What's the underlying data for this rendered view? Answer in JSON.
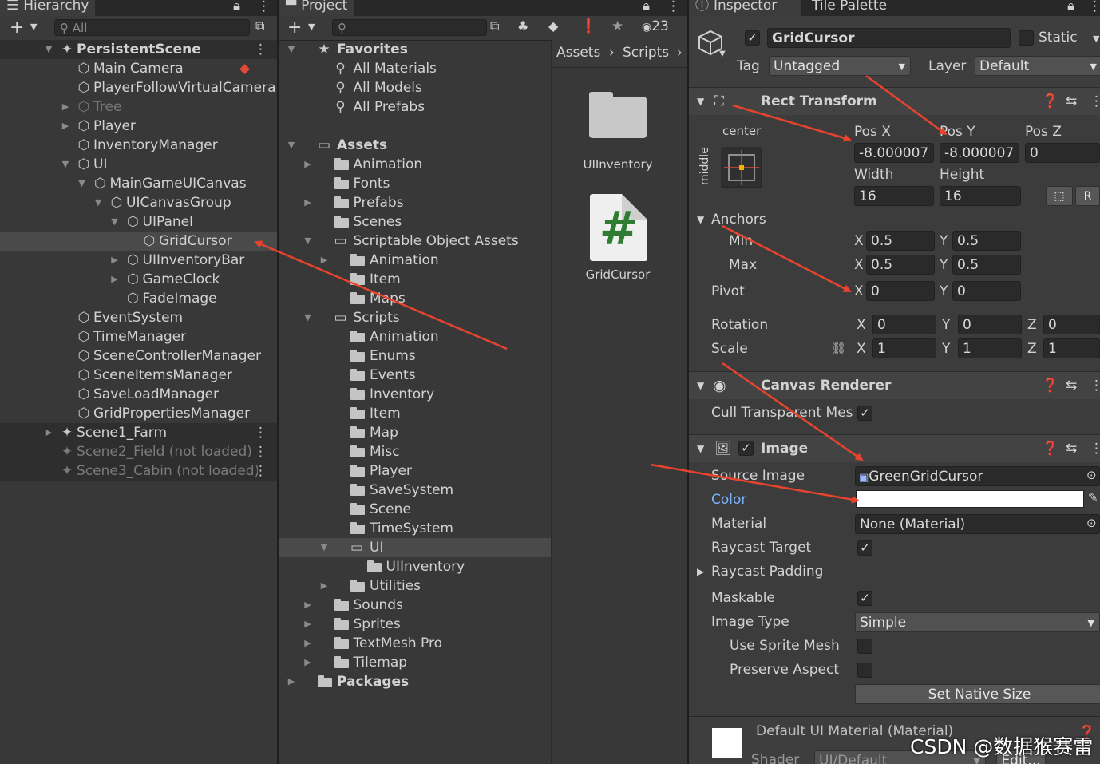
{
  "hierarchy": {
    "tab": "Hierarchy",
    "search": "All",
    "rows": [
      {
        "label": "PersistentScene",
        "depth": 0,
        "icon": "scene-icon",
        "arrow": "open",
        "scene": true,
        "bold": true,
        "menu": true
      },
      {
        "label": "Main Camera",
        "depth": 2,
        "icon": "cube-icon",
        "arrow": "",
        "badge": true
      },
      {
        "label": "PlayerFollowVirtualCamera",
        "depth": 2,
        "icon": "cube-icon",
        "arrow": ""
      },
      {
        "label": "Tree",
        "depth": 2,
        "icon": "cube-icon",
        "arrow": "closed",
        "dim": true
      },
      {
        "label": "Player",
        "depth": 2,
        "icon": "cube-icon",
        "arrow": "closed"
      },
      {
        "label": "InventoryManager",
        "depth": 2,
        "icon": "cube-icon",
        "arrow": ""
      },
      {
        "label": "UI",
        "depth": 2,
        "icon": "cube-icon",
        "arrow": "open"
      },
      {
        "label": "MainGameUICanvas",
        "depth": 3,
        "icon": "cube-icon",
        "arrow": "open"
      },
      {
        "label": "UICanvasGroup",
        "depth": 4,
        "icon": "cube-icon",
        "arrow": "open"
      },
      {
        "label": "UIPanel",
        "depth": 5,
        "icon": "cube-icon",
        "arrow": "open"
      },
      {
        "label": "GridCursor",
        "depth": 6,
        "icon": "cube-icon",
        "arrow": "",
        "selected": true
      },
      {
        "label": "UIInventoryBar",
        "depth": 5,
        "icon": "cube-icon",
        "arrow": "closed"
      },
      {
        "label": "GameClock",
        "depth": 5,
        "icon": "cube-icon",
        "arrow": "closed"
      },
      {
        "label": "FadeImage",
        "depth": 5,
        "icon": "cube-icon",
        "arrow": ""
      },
      {
        "label": "EventSystem",
        "depth": 2,
        "icon": "cube-icon",
        "arrow": ""
      },
      {
        "label": "TimeManager",
        "depth": 2,
        "icon": "cube-icon",
        "arrow": ""
      },
      {
        "label": "SceneControllerManager",
        "depth": 2,
        "icon": "cube-icon",
        "arrow": ""
      },
      {
        "label": "SceneItemsManager",
        "depth": 2,
        "icon": "cube-icon",
        "arrow": ""
      },
      {
        "label": "SaveLoadManager",
        "depth": 2,
        "icon": "cube-icon",
        "arrow": ""
      },
      {
        "label": "GridPropertiesManager",
        "depth": 2,
        "icon": "cube-icon",
        "arrow": ""
      },
      {
        "label": "Scene1_Farm",
        "depth": 0,
        "icon": "scene-icon",
        "arrow": "closed",
        "scene": true,
        "menu": true
      },
      {
        "label": "Scene2_Field (not loaded)",
        "depth": 0,
        "icon": "scene-icon",
        "arrow": "",
        "scene": true,
        "dim": true,
        "menu": true
      },
      {
        "label": "Scene3_Cabin (not loaded)",
        "depth": 0,
        "icon": "scene-icon",
        "arrow": "",
        "scene": true,
        "dim": true,
        "menu": true
      }
    ]
  },
  "project": {
    "tab": "Project",
    "hidden_count": "23",
    "breadcrumb": [
      "Assets",
      "Scripts"
    ],
    "tree": [
      {
        "label": "Favorites",
        "depth": 0,
        "icon": "star-icon",
        "arrow": "open",
        "bold": true
      },
      {
        "label": "All Materials",
        "depth": 1,
        "icon": "search-icon",
        "arrow": ""
      },
      {
        "label": "All Models",
        "depth": 1,
        "icon": "search-icon",
        "arrow": ""
      },
      {
        "label": "All Prefabs",
        "depth": 1,
        "icon": "search-icon",
        "arrow": ""
      },
      {
        "label": "",
        "depth": 0,
        "icon": "",
        "arrow": "",
        "spacer": true
      },
      {
        "label": "Assets",
        "depth": 0,
        "icon": "folder-open-icon",
        "arrow": "open",
        "bold": true
      },
      {
        "label": "Animation",
        "depth": 1,
        "icon": "folder-icon",
        "arrow": "closed"
      },
      {
        "label": "Fonts",
        "depth": 1,
        "icon": "folder-icon",
        "arrow": ""
      },
      {
        "label": "Prefabs",
        "depth": 1,
        "icon": "folder-icon",
        "arrow": "closed"
      },
      {
        "label": "Scenes",
        "depth": 1,
        "icon": "folder-icon",
        "arrow": ""
      },
      {
        "label": "Scriptable Object Assets",
        "depth": 1,
        "icon": "folder-open-icon",
        "arrow": "open"
      },
      {
        "label": "Animation",
        "depth": 2,
        "icon": "folder-icon",
        "arrow": "closed"
      },
      {
        "label": "Item",
        "depth": 2,
        "icon": "folder-icon",
        "arrow": ""
      },
      {
        "label": "Maps",
        "depth": 2,
        "icon": "folder-icon",
        "arrow": ""
      },
      {
        "label": "Scripts",
        "depth": 1,
        "icon": "folder-open-icon",
        "arrow": "open"
      },
      {
        "label": "Animation",
        "depth": 2,
        "icon": "folder-icon",
        "arrow": ""
      },
      {
        "label": "Enums",
        "depth": 2,
        "icon": "folder-icon",
        "arrow": ""
      },
      {
        "label": "Events",
        "depth": 2,
        "icon": "folder-icon",
        "arrow": ""
      },
      {
        "label": "Inventory",
        "depth": 2,
        "icon": "folder-icon",
        "arrow": ""
      },
      {
        "label": "Item",
        "depth": 2,
        "icon": "folder-icon",
        "arrow": ""
      },
      {
        "label": "Map",
        "depth": 2,
        "icon": "folder-icon",
        "arrow": ""
      },
      {
        "label": "Misc",
        "depth": 2,
        "icon": "folder-icon",
        "arrow": ""
      },
      {
        "label": "Player",
        "depth": 2,
        "icon": "folder-icon",
        "arrow": ""
      },
      {
        "label": "SaveSystem",
        "depth": 2,
        "icon": "folder-icon",
        "arrow": ""
      },
      {
        "label": "Scene",
        "depth": 2,
        "icon": "folder-icon",
        "arrow": ""
      },
      {
        "label": "TimeSystem",
        "depth": 2,
        "icon": "folder-icon",
        "arrow": ""
      },
      {
        "label": "UI",
        "depth": 2,
        "icon": "folder-open-icon",
        "arrow": "open",
        "selected": true
      },
      {
        "label": "UIInventory",
        "depth": 3,
        "icon": "folder-icon",
        "arrow": ""
      },
      {
        "label": "Utilities",
        "depth": 2,
        "icon": "folder-icon",
        "arrow": "closed"
      },
      {
        "label": "Sounds",
        "depth": 1,
        "icon": "folder-icon",
        "arrow": "closed"
      },
      {
        "label": "Sprites",
        "depth": 1,
        "icon": "folder-icon",
        "arrow": "closed"
      },
      {
        "label": "TextMesh Pro",
        "depth": 1,
        "icon": "folder-icon",
        "arrow": "closed"
      },
      {
        "label": "Tilemap",
        "depth": 1,
        "icon": "folder-icon",
        "arrow": "closed"
      },
      {
        "label": "Packages",
        "depth": 0,
        "icon": "folder-icon",
        "arrow": "closed",
        "bold": true
      }
    ],
    "assets": [
      {
        "label": "UIInventory",
        "type": "folder"
      },
      {
        "label": "GridCursor",
        "type": "script",
        "glyph": "#"
      }
    ]
  },
  "inspector": {
    "tabs": [
      "Inspector",
      "Tile Palette"
    ],
    "object_name": "GridCursor",
    "static_label": "Static",
    "tag_label": "Tag",
    "tag_value": "Untagged",
    "layer_label": "Layer",
    "layer_value": "Default",
    "rect_transform": {
      "title": "Rect Transform",
      "anchor_h": "center",
      "anchor_v": "middle",
      "pos_x_label": "Pos X",
      "pos_y_label": "Pos Y",
      "pos_z_label": "Pos Z",
      "pos_x": "-8.000007",
      "pos_y": "-8.000007",
      "pos_z": "0",
      "width_label": "Width",
      "height_label": "Height",
      "width": "16",
      "height": "16",
      "raw_label": "R",
      "anchors_label": "Anchors",
      "min_label": "Min",
      "max_label": "Max",
      "pivot_label": "Pivot",
      "x": "X",
      "y": "Y",
      "z": "Z",
      "min_x": "0.5",
      "min_y": "0.5",
      "max_x": "0.5",
      "max_y": "0.5",
      "pivot_x": "0",
      "pivot_y": "0",
      "rotation_label": "Rotation",
      "rot_x": "0",
      "rot_y": "0",
      "rot_z": "0",
      "scale_label": "Scale",
      "scale_x": "1",
      "scale_y": "1",
      "scale_z": "1"
    },
    "canvas_renderer": {
      "title": "Canvas Renderer",
      "cull_label": "Cull Transparent Mesh"
    },
    "image": {
      "title": "Image",
      "source_label": "Source Image",
      "source_value": "GreenGridCursor",
      "color_label": "Color",
      "color_value": "#ffffff",
      "material_label": "Material",
      "material_value": "None (Material)",
      "raycast_target_label": "Raycast Target",
      "raycast_padding_label": "Raycast Padding",
      "maskable_label": "Maskable",
      "image_type_label": "Image Type",
      "image_type_value": "Simple",
      "use_sprite_mesh_label": "Use Sprite Mesh",
      "preserve_aspect_label": "Preserve Aspect",
      "set_native_size_label": "Set Native Size"
    },
    "material_footer": {
      "title": "Default UI Material (Material)",
      "shader_label": "Shader",
      "shader_value": "UI/Default",
      "edit_label": "Edit..."
    }
  },
  "watermark": "CSDN @数据猴赛雷",
  "colors": {
    "annotation_arrow": "#e8432e",
    "script_icon": "#2e7d32",
    "link_label": "#7fb2ff"
  }
}
